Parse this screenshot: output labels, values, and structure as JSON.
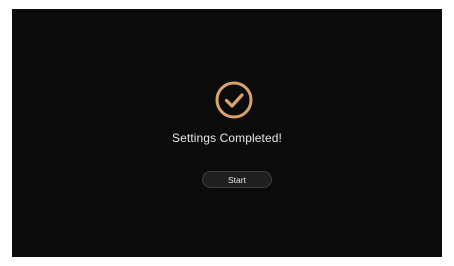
{
  "dialog": {
    "title": "Settings Completed!",
    "start_label": "Start",
    "icon": "check-circle-icon"
  },
  "colors": {
    "background": "#0b0b0b",
    "accent": "#d8a36a",
    "text": "#e6e6e6",
    "button_bg": "#1f1f1f"
  }
}
